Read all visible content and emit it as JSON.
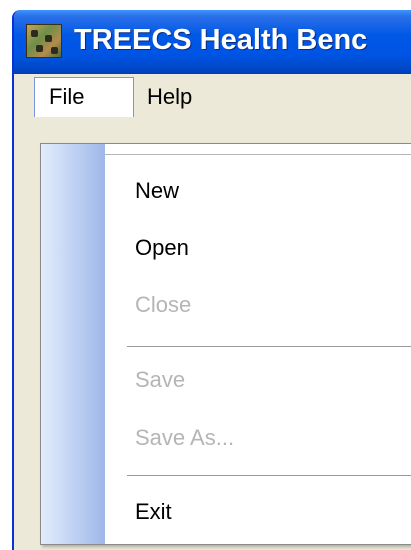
{
  "window": {
    "title": "TREECS Health Benc",
    "icon": "treecs-app-icon",
    "title_bar_color": "#0054e3"
  },
  "menubar": {
    "items": [
      {
        "label": "File",
        "state": "open"
      },
      {
        "label": "Help",
        "state": "closed"
      }
    ]
  },
  "file_menu": {
    "items": [
      {
        "label": "New",
        "enabled": true
      },
      {
        "label": "Open",
        "enabled": true
      },
      {
        "label": "Close",
        "enabled": false
      },
      {
        "label": "Save",
        "enabled": false
      },
      {
        "label": "Save As...",
        "enabled": false
      },
      {
        "label": "Exit",
        "enabled": true
      }
    ]
  }
}
